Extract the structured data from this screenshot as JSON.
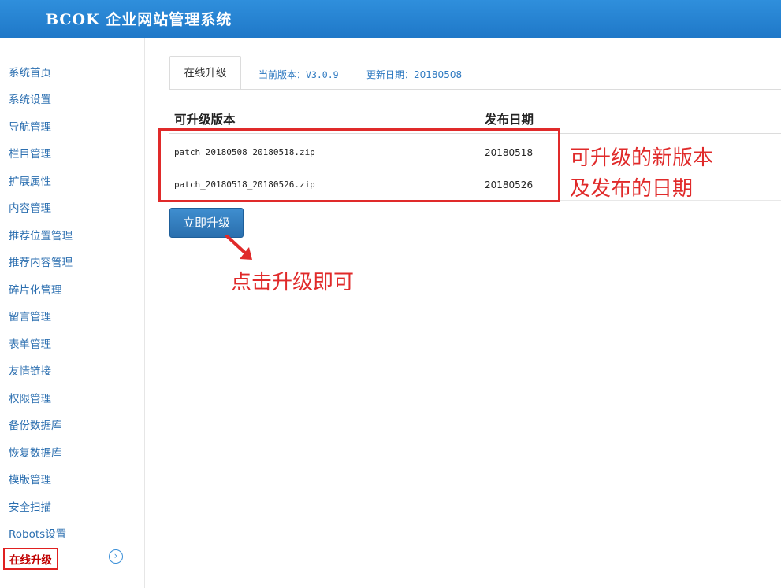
{
  "header": {
    "title": "BCOK 企业网站管理系统"
  },
  "sidebar": {
    "items": [
      {
        "label": "系统首页"
      },
      {
        "label": "系统设置"
      },
      {
        "label": "导航管理"
      },
      {
        "label": "栏目管理"
      },
      {
        "label": "扩展属性"
      },
      {
        "label": "内容管理"
      },
      {
        "label": "推荐位置管理"
      },
      {
        "label": "推荐内容管理"
      },
      {
        "label": "碎片化管理"
      },
      {
        "label": "留言管理"
      },
      {
        "label": "表单管理"
      },
      {
        "label": "友情链接"
      },
      {
        "label": "权限管理"
      },
      {
        "label": "备份数据库"
      },
      {
        "label": "恢复数据库"
      },
      {
        "label": "模版管理"
      },
      {
        "label": "安全扫描"
      },
      {
        "label": "Robots设置"
      },
      {
        "label": "在线升级",
        "active": true
      }
    ],
    "collapse_icon": "chevron-right-circle-icon"
  },
  "tabs": {
    "active_label": "在线升级",
    "version_label": "当前版本：",
    "version_value": "V3.0.9",
    "date_label": "更新日期：",
    "date_value": "20180508"
  },
  "table": {
    "columns": [
      "可升级版本",
      "发布日期"
    ],
    "rows": [
      {
        "file": "patch_20180508_20180518.zip",
        "date": "20180518"
      },
      {
        "file": "patch_20180518_20180526.zip",
        "date": "20180526"
      }
    ]
  },
  "actions": {
    "upgrade_label": "立即升级"
  },
  "annotations": {
    "box_note_line1": "可升级的新版本",
    "box_note_line2": "及发布的日期",
    "button_note": "点击升级即可",
    "highlight_color": "#e02a2a"
  },
  "colors": {
    "header": "#2283d2",
    "link": "#2c6fb0",
    "button": "#3579b8"
  }
}
